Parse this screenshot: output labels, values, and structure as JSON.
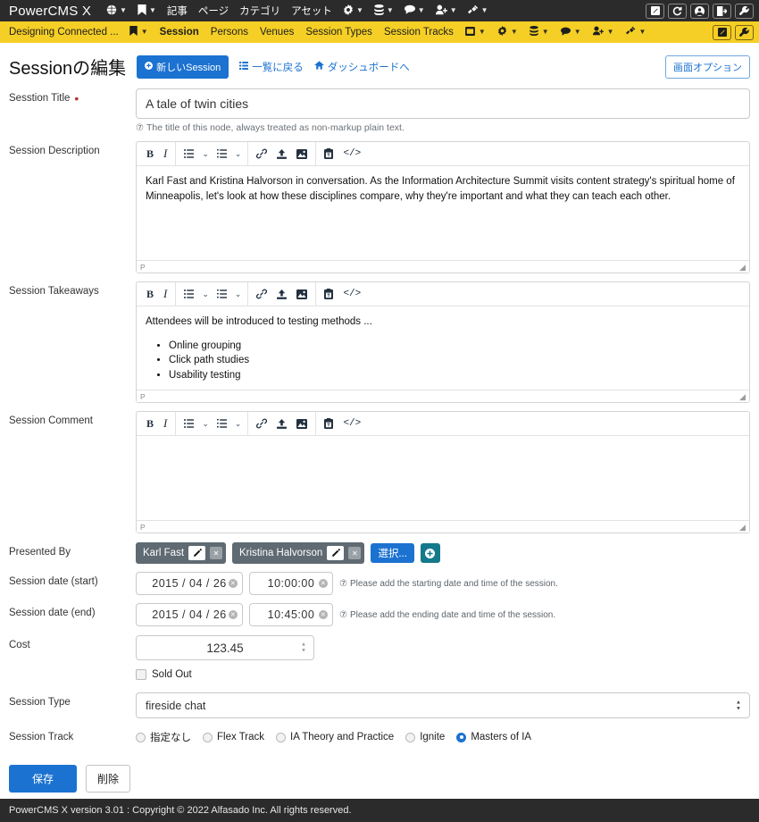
{
  "topbar": {
    "brand": "PowerCMS X",
    "nav": [
      {
        "label": "",
        "icon": "globe-icon",
        "caret": true
      },
      {
        "label": "",
        "icon": "bookmark-icon",
        "caret": true
      },
      {
        "label": "記事",
        "icon": "",
        "caret": false
      },
      {
        "label": "ページ",
        "icon": "",
        "caret": false
      },
      {
        "label": "カテゴリ",
        "icon": "",
        "caret": false
      },
      {
        "label": "アセット",
        "icon": "",
        "caret": false
      },
      {
        "label": "",
        "icon": "gear-icon",
        "caret": true
      },
      {
        "label": "",
        "icon": "database-icon",
        "caret": true
      },
      {
        "label": "",
        "icon": "comment-icon",
        "caret": true
      },
      {
        "label": "",
        "icon": "user-add-icon",
        "caret": true
      },
      {
        "label": "",
        "icon": "plug-icon",
        "caret": true
      }
    ],
    "icons": [
      "edit-square-icon",
      "refresh-icon",
      "user-circle-icon",
      "logout-icon",
      "wrench-icon"
    ]
  },
  "sitebar": {
    "site_name": "Designing Connected ...",
    "bookmark_icon": "bookmark-icon",
    "nav": [
      {
        "label": "Session",
        "active": true
      },
      {
        "label": "Persons",
        "active": false
      },
      {
        "label": "Venues",
        "active": false
      },
      {
        "label": "Session Types",
        "active": false
      },
      {
        "label": "Session Tracks",
        "active": false
      }
    ],
    "menu_icons": [
      "window-icon",
      "gear-icon",
      "database-icon",
      "comment-icon",
      "user-add-icon",
      "plug-icon"
    ],
    "right_icons": [
      "edit-square-icon",
      "wrench-icon"
    ]
  },
  "header": {
    "title": "Sessionの編集",
    "new_button": "新しいSession",
    "back_link": "一覧に戻る",
    "dashboard_link": "ダッシュボードへ",
    "screen_options": "画面オプション"
  },
  "fields": {
    "title": {
      "label": "Sesstion Title",
      "required": true,
      "value": "A tale of twin cities",
      "hint": "The title of this node, always treated as non-markup plain text."
    },
    "description": {
      "label": "Session Description",
      "paragraph": "Karl Fast and Kristina Halvorson in conversation. As the Information Architecture Summit visits content strategy's spiritual home of Minneapolis, let's look at how these disciplines compare, why they're important and what they can teach each other.",
      "status": "P"
    },
    "takeaways": {
      "label": "Session Takeaways",
      "paragraph": "Attendees will be introduced to testing methods ...",
      "bullets": [
        "Online grouping",
        "Click path studies",
        "Usability testing"
      ],
      "status": "P"
    },
    "comment": {
      "label": "Session Comment",
      "paragraph": "",
      "status": "P"
    },
    "presented_by": {
      "label": "Presented By",
      "tags": [
        "Karl Fast",
        "Kristina Halvorson"
      ],
      "select_button": "選択...",
      "add_button": "+"
    },
    "date_start": {
      "label": "Session date (start)",
      "date": "2015 / 04 / 26",
      "time": "10:00:00",
      "hint": "Please add the starting date and time of the session."
    },
    "date_end": {
      "label": "Session date (end)",
      "date": "2015 / 04 / 26",
      "time": "10:45:00",
      "hint": "Please add the ending date and time of the session."
    },
    "cost": {
      "label": "Cost",
      "value": "123.45"
    },
    "sold_out": {
      "label": "Sold Out",
      "checked": false
    },
    "session_type": {
      "label": "Session Type",
      "value": "fireside chat"
    },
    "session_track": {
      "label": "Session Track",
      "options": [
        {
          "label": "指定なし",
          "selected": false
        },
        {
          "label": "Flex Track",
          "selected": false
        },
        {
          "label": "IA Theory and Practice",
          "selected": false
        },
        {
          "label": "Ignite",
          "selected": false
        },
        {
          "label": "Masters of IA",
          "selected": true
        }
      ]
    }
  },
  "editor_toolbar": {
    "bold": "B",
    "italic": "I",
    "icons": [
      "unordered-list-icon",
      "ordered-list-icon",
      "link-icon",
      "upload-icon",
      "image-icon",
      "paste-icon",
      "source-code-icon"
    ],
    "code_label": "</>"
  },
  "actions": {
    "save": "保存",
    "delete": "削除"
  },
  "footer": {
    "text": "PowerCMS X version 3.01 : Copyright © 2022 Alfasado Inc. All rights reserved."
  },
  "colors": {
    "accent_blue": "#1b72d0",
    "brand_yellow": "#f5cf25",
    "dark_bar": "#2b2b2b",
    "teal": "#15798c",
    "tag_gray": "#5f6a72"
  }
}
